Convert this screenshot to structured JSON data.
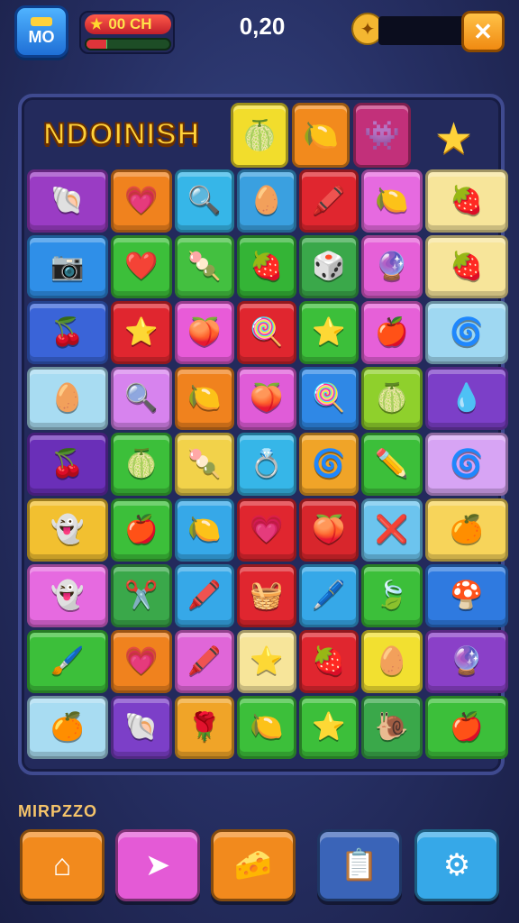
{
  "header": {
    "level_badge": "MO",
    "coins": "00 CH",
    "progress": 0.25,
    "score": "0,20",
    "close_symbol": "✕"
  },
  "board": {
    "title": "NDOINISH",
    "goals": [
      {
        "icon": "melon-icon",
        "glyph": "🍈",
        "color": "#f2dd2c"
      },
      {
        "icon": "lemon-icon",
        "glyph": "🍋",
        "color": "#f28a1d"
      },
      {
        "icon": "purple-monster-icon",
        "glyph": "👾",
        "color": "#c2307a"
      }
    ],
    "rows": [
      [
        [
          "#9a3cc4",
          "shell-icon",
          "🐚"
        ],
        [
          "#f0821e",
          "heart-icon",
          "💗"
        ],
        [
          "#36b6e8",
          "magnifier-icon",
          "🔍"
        ],
        [
          "#3aa0e0",
          "gem-icon",
          "🥚"
        ],
        [
          "#e0262f",
          "crayon-icon",
          "🖍️"
        ],
        [
          "#e66ae0",
          "lemon-icon",
          "🍋"
        ],
        [
          "#f7e59a",
          "strawberry-icon",
          "🍓"
        ]
      ],
      [
        [
          "#2f8fe8",
          "camera-icon",
          "📷"
        ],
        [
          "#3cbf3a",
          "heart-icon",
          "❤️"
        ],
        [
          "#43c040",
          "popsicle-icon",
          "🍡"
        ],
        [
          "#34b436",
          "strawberry-icon",
          "🍓"
        ],
        [
          "#3aa84a",
          "dice-icon",
          "🎲"
        ],
        [
          "#e660d8",
          "purple-egg-icon",
          "🔮"
        ],
        [
          "#f7e59a",
          "strawberry-icon",
          "🍓"
        ]
      ],
      [
        [
          "#3a64d8",
          "berry-icon",
          "🍒"
        ],
        [
          "#e0262f",
          "star-icon",
          "⭐"
        ],
        [
          "#e85bd8",
          "plum-icon",
          "🍑"
        ],
        [
          "#e0262f",
          "lollipop-icon",
          "🍭"
        ],
        [
          "#3cbf3a",
          "star-icon",
          "⭐"
        ],
        [
          "#e660d8",
          "apple-icon",
          "🍎"
        ],
        [
          "#9fd8f2",
          "spiral-icon",
          "🌀"
        ]
      ],
      [
        [
          "#a8dcf2",
          "red-egg-icon",
          "🥚"
        ],
        [
          "#d783ee",
          "magnifier-icon",
          "🔍"
        ],
        [
          "#f0821e",
          "lemon-icon",
          "🍋"
        ],
        [
          "#e05cd8",
          "plum-icon",
          "🍑"
        ],
        [
          "#2f88e6",
          "lollipop-icon",
          "🍭"
        ],
        [
          "#8fd02c",
          "melon-icon",
          "🍈"
        ],
        [
          "#7c3fc8",
          "blue-blob-icon",
          "💧"
        ]
      ],
      [
        [
          "#6a2fb8",
          "cherry-icon",
          "🍒"
        ],
        [
          "#3cbf3a",
          "melon-icon",
          "🍈"
        ],
        [
          "#f2d24a",
          "popsicle-icon",
          "🍡"
        ],
        [
          "#36b6e8",
          "ring-icon",
          "💍"
        ],
        [
          "#f0a428",
          "spiral-icon",
          "🌀"
        ],
        [
          "#3cbf3a",
          "pencil-icon",
          "✏️"
        ],
        [
          "#d7a4f4",
          "swirl-icon",
          "🌀"
        ]
      ],
      [
        [
          "#f2c030",
          "blue-monster-icon",
          "👻"
        ],
        [
          "#3cbf3a",
          "apple-icon",
          "🍎"
        ],
        [
          "#36a8e8",
          "lemon-icon",
          "🍋"
        ],
        [
          "#e0262f",
          "heart-icon",
          "💗"
        ],
        [
          "#d8262c",
          "plum-icon",
          "🍑"
        ],
        [
          "#6cc4ee",
          "crossed-icon",
          "❌"
        ],
        [
          "#f7d45a",
          "orange-icon",
          "🍊"
        ]
      ],
      [
        [
          "#e66ae0",
          "blue-monster-icon",
          "👻"
        ],
        [
          "#3aa84a",
          "scissors-icon",
          "✂️"
        ],
        [
          "#36a8e8",
          "crayon-icon",
          "🖍️"
        ],
        [
          "#e0262f",
          "basket-icon",
          "🧺"
        ],
        [
          "#36a8e8",
          "marker-icon",
          "🖊️"
        ],
        [
          "#3cbf3a",
          "leaf-icon",
          "🍃"
        ],
        [
          "#2f7ae0",
          "mushroom-icon",
          "🍄"
        ]
      ],
      [
        [
          "#3cbf3a",
          "brush-icon",
          "🖌️"
        ],
        [
          "#f0821e",
          "heart-icon",
          "💗"
        ],
        [
          "#e066d8",
          "crayon-icon",
          "🖍️"
        ],
        [
          "#f7e59a",
          "blue-star-icon",
          "⭐"
        ],
        [
          "#e0262f",
          "strawberry-icon",
          "🍓"
        ],
        [
          "#f2e030",
          "red-egg-icon",
          "🥚"
        ],
        [
          "#8a40c8",
          "purple-egg-icon",
          "🔮"
        ]
      ],
      [
        [
          "#a8dcf2",
          "orange-icon",
          "🍊"
        ],
        [
          "#7c3fc8",
          "seashell-icon",
          "🐚"
        ],
        [
          "#f0a428",
          "rose-icon",
          "🌹"
        ],
        [
          "#3cbf3a",
          "lemon-icon",
          "🍋"
        ],
        [
          "#3cbf3a",
          "star-icon",
          "⭐"
        ],
        [
          "#3aa84a",
          "snail-icon",
          "🐌"
        ],
        [
          "#3cbf3a",
          "apple-icon",
          "🍎"
        ]
      ]
    ]
  },
  "footer": {
    "label": "MIRPZZO",
    "buttons": [
      {
        "name": "home-button",
        "icon": "home-icon",
        "glyph": "⌂",
        "color": "#f28a1d"
      },
      {
        "name": "share-button",
        "icon": "arrow-icon",
        "glyph": "➤",
        "color": "#e45ad6"
      },
      {
        "name": "cheese-button",
        "icon": "cheese-icon",
        "glyph": "🧀",
        "color": "#f28a1d"
      },
      {
        "name": "list-button",
        "icon": "clipboard-icon",
        "glyph": "📋",
        "color": "#3a64b8"
      },
      {
        "name": "settings-button",
        "icon": "gear-icon",
        "glyph": "⚙",
        "color": "#36a8e8"
      }
    ]
  }
}
